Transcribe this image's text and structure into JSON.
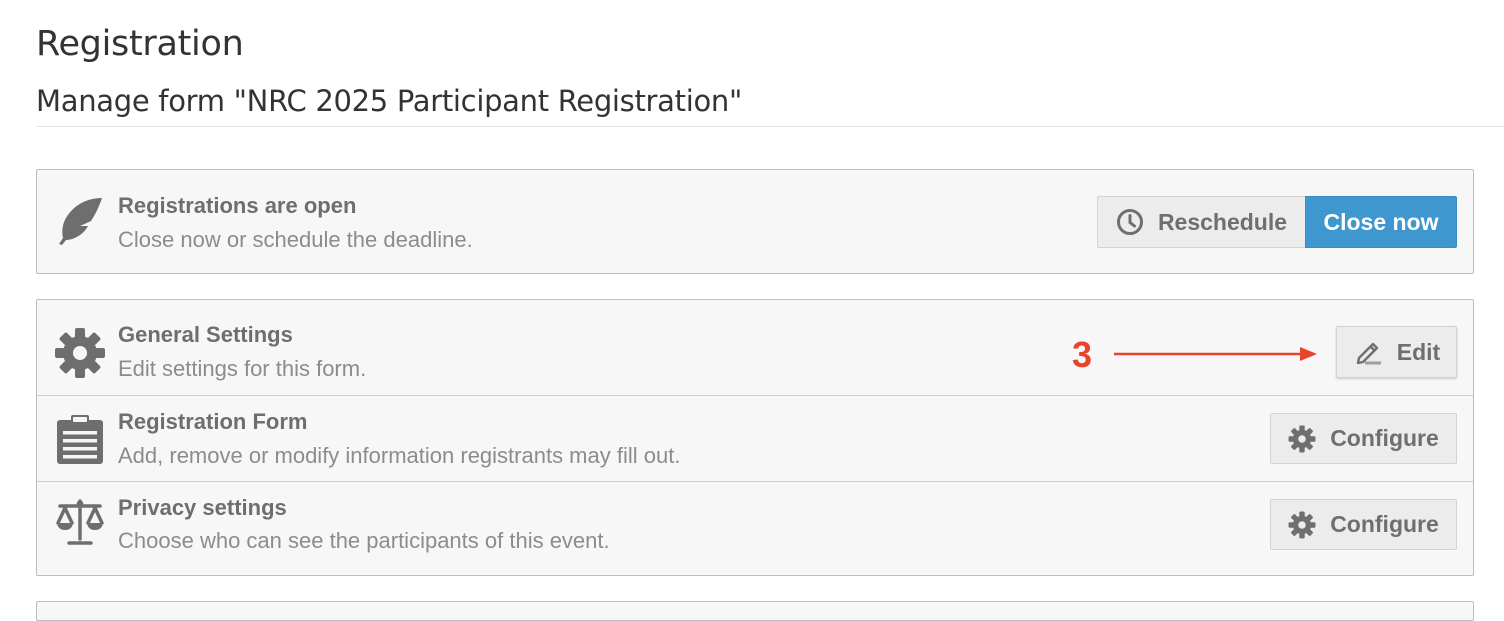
{
  "header": {
    "title": "Registration",
    "subtitle": "Manage form \"NRC 2025 Participant Registration\""
  },
  "status_panel": {
    "icon": "feather-icon",
    "title": "Registrations are open",
    "description": "Close now or schedule the deadline.",
    "reschedule_label": "Reschedule",
    "reschedule_icon": "clock-icon",
    "close_label": "Close now"
  },
  "settings_panel": {
    "rows": [
      {
        "icon": "gear-icon",
        "title": "General Settings",
        "description": "Edit settings for this form.",
        "button_label": "Edit",
        "button_icon": "pencil-icon"
      },
      {
        "icon": "clipboard-icon",
        "title": "Registration Form",
        "description": "Add, remove or modify information registrants may fill out.",
        "button_label": "Configure",
        "button_icon": "gear-icon"
      },
      {
        "icon": "scales-icon",
        "title": "Privacy settings",
        "description": "Choose who can see the participants of this event.",
        "button_label": "Configure",
        "button_icon": "gear-icon"
      }
    ]
  },
  "annotation": {
    "number": "3",
    "color": "#e8432b"
  },
  "colors": {
    "primary": "#3e98cf",
    "panel_bg": "#f7f7f7",
    "annotation": "#e8432b"
  }
}
